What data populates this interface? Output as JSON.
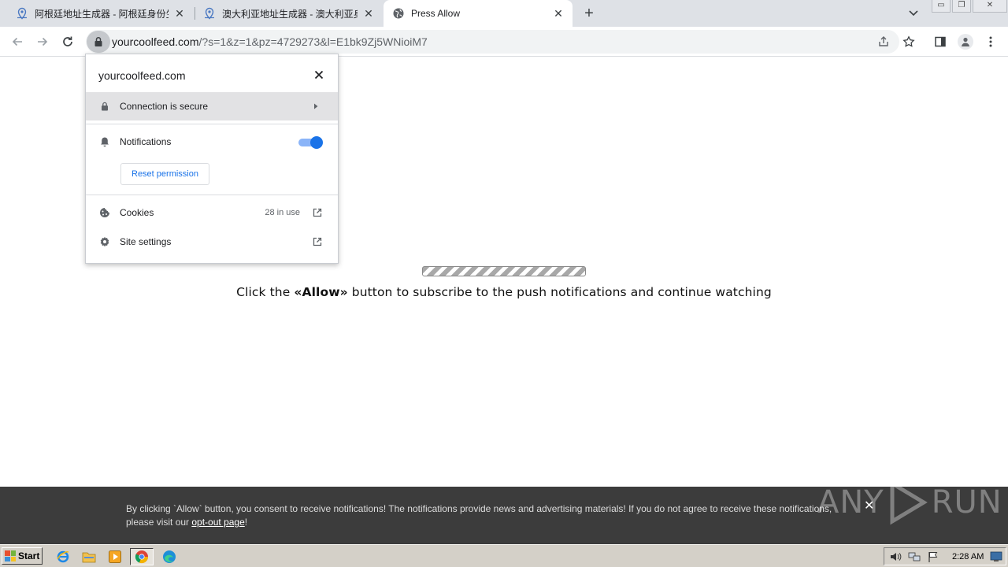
{
  "tabs": [
    {
      "title": "阿根廷地址生成器 - 阿根廷身份生成",
      "active": false,
      "icon": "map-pin-icon"
    },
    {
      "title": "澳大利亚地址生成器 - 澳大利亚身份",
      "active": false,
      "icon": "map-pin-icon"
    },
    {
      "title": "Press Allow",
      "active": true,
      "icon": "globe-icon"
    }
  ],
  "omnibox": {
    "domain": "yourcoolfeed.com",
    "rest": "/?s=1&z=1&pz=4729273&l=E1bk9Zj5WNioiM7"
  },
  "site_popup": {
    "domain": "yourcoolfeed.com",
    "connection_label": "Connection is secure",
    "notifications_label": "Notifications",
    "notifications_enabled": true,
    "reset_label": "Reset permission",
    "cookies_label": "Cookies",
    "cookies_count": "28 in use",
    "site_settings_label": "Site settings"
  },
  "page": {
    "message_pre": "Click the ",
    "message_bold": "«Allow»",
    "message_post": " button to subscribe to the push notifications and continue watching"
  },
  "consent": {
    "text_main": "By clicking `Allow` button, you consent to receive notifications! The notifications provide news and advertising materials! If you do not agree to receive these notifications, please visit our ",
    "link_text": "opt-out page",
    "text_end": "!"
  },
  "watermark": "ANY RUN",
  "taskbar": {
    "start_label": "Start",
    "clock": "2:28 AM"
  },
  "colors": {
    "accent": "#1a73e8",
    "tabstrip": "#dee1e6",
    "consent_bg": "#3c3c3c",
    "taskbar": "#d4d0c8"
  }
}
